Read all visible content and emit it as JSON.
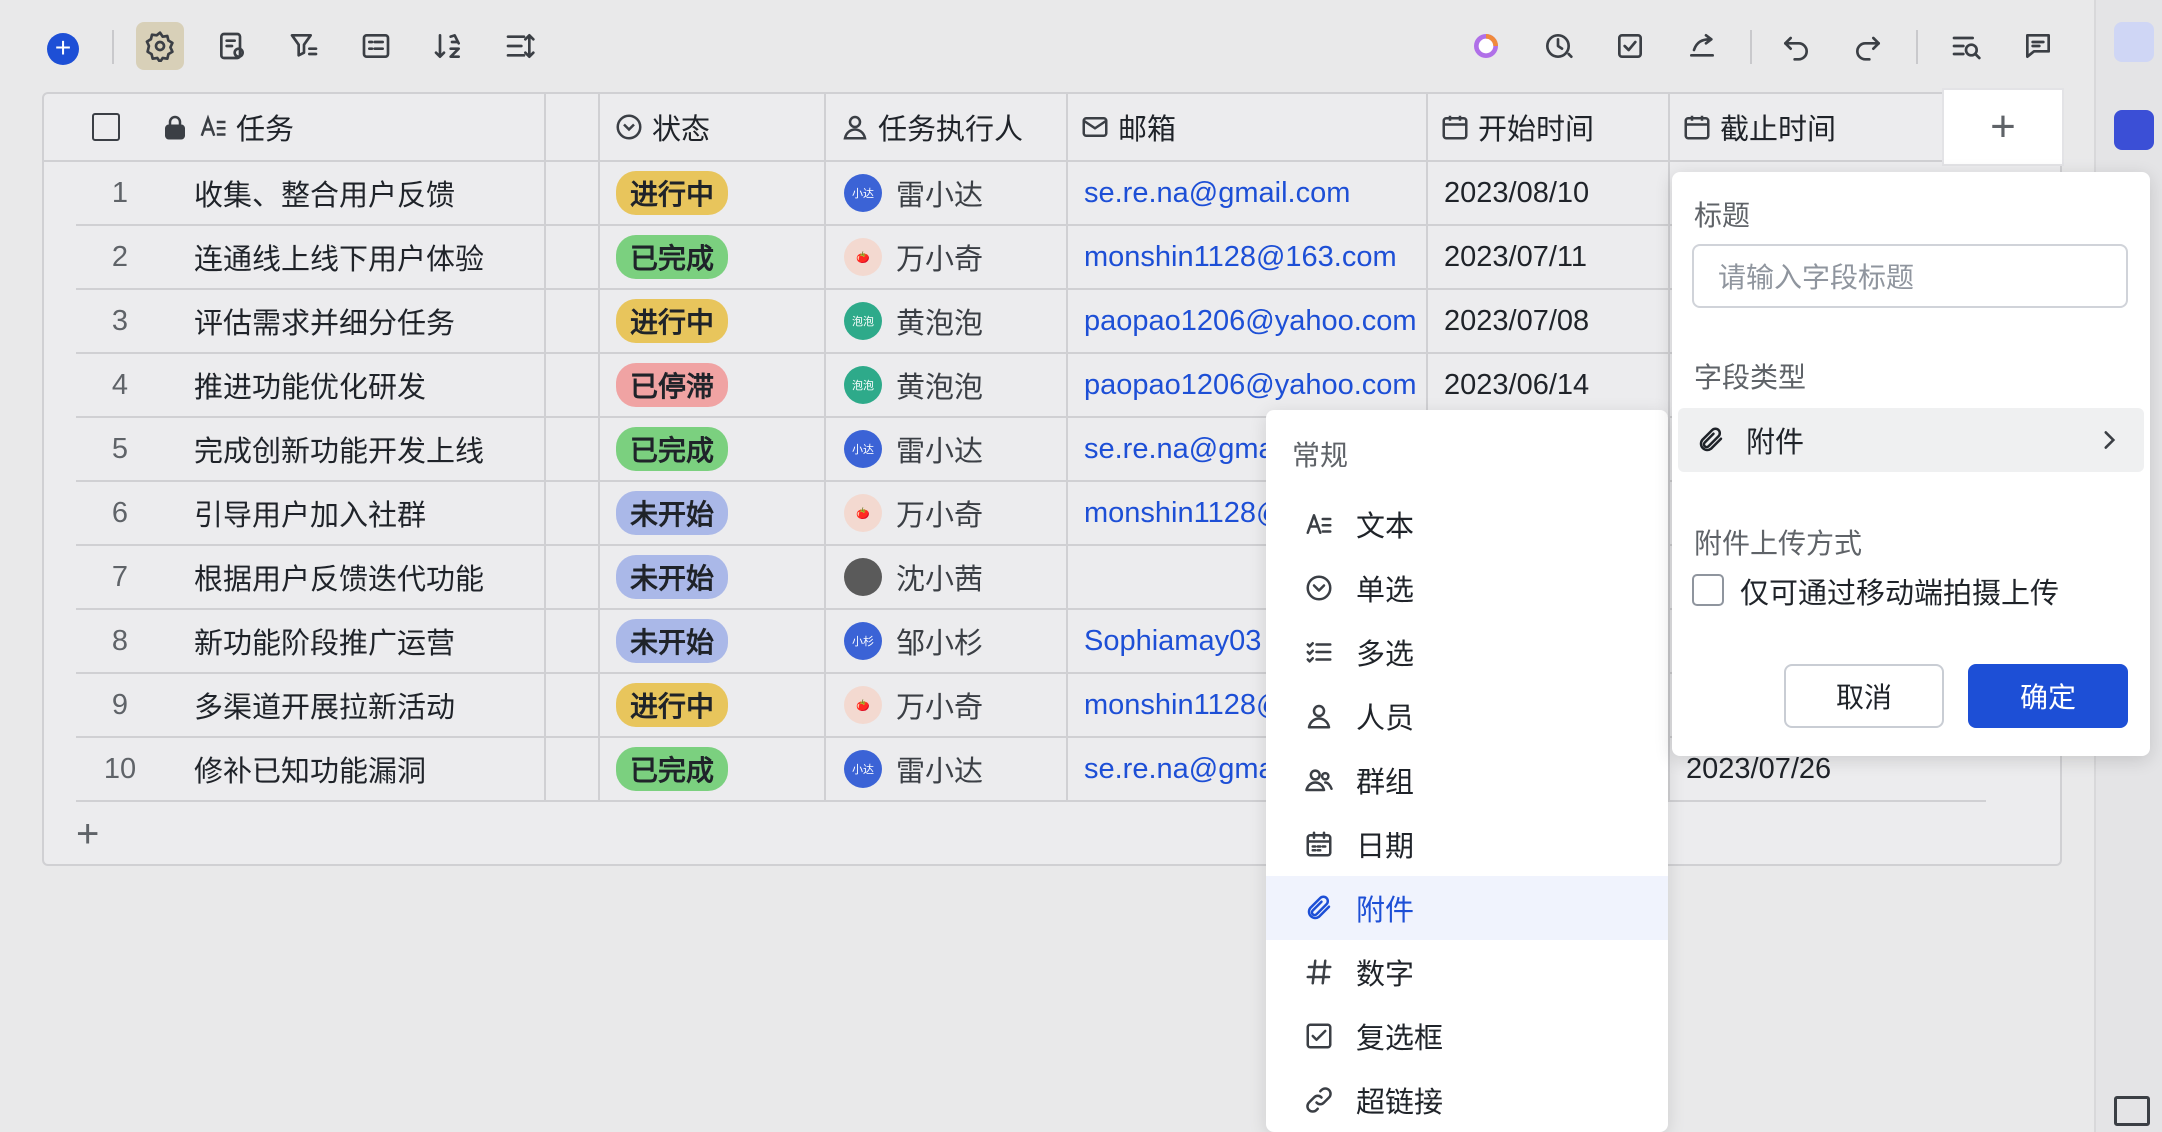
{
  "toolbar": {
    "left_tools": [
      "add",
      "settings",
      "field-settings",
      "filter",
      "group",
      "sort",
      "row-height"
    ],
    "right_tools": [
      "ai-assistant",
      "history",
      "task",
      "share",
      "undo",
      "redo",
      "search",
      "comments"
    ]
  },
  "columns": {
    "task": "任务",
    "status": "状态",
    "assignee": "任务执行人",
    "email": "邮箱",
    "start": "开始时间",
    "due": "截止时间"
  },
  "rows": [
    {
      "num": "1",
      "task": "收集、整合用户反馈",
      "status": "进行中",
      "status_color": "#e8c55c",
      "assignee": "雷小达",
      "avatar_text": "小达",
      "avatar_color": "#3b63d6",
      "email": "se.re.na@gmail.com",
      "start": "2023/08/10"
    },
    {
      "num": "2",
      "task": "连通线上线下用户体验",
      "status": "已完成",
      "status_color": "#7bd07f",
      "assignee": "万小奇",
      "avatar_text": "🍅",
      "avatar_color": "#f3d9d0",
      "email": "monshin1128@163.com",
      "start": "2023/07/11"
    },
    {
      "num": "3",
      "task": "评估需求并细分任务",
      "status": "进行中",
      "status_color": "#e8c55c",
      "assignee": "黄泡泡",
      "avatar_text": "泡泡",
      "avatar_color": "#2eaa8a",
      "email": "paopao1206@yahoo.com",
      "start": "2023/07/08"
    },
    {
      "num": "4",
      "task": "推进功能优化研发",
      "status": "已停滞",
      "status_color": "#f0a3a3",
      "assignee": "黄泡泡",
      "avatar_text": "泡泡",
      "avatar_color": "#2eaa8a",
      "email": "paopao1206@yahoo.com",
      "start": "2023/06/14"
    },
    {
      "num": "5",
      "task": "完成创新功能开发上线",
      "status": "已完成",
      "status_color": "#7bd07f",
      "assignee": "雷小达",
      "avatar_text": "小达",
      "avatar_color": "#3b63d6",
      "email": "se.re.na@gma",
      "start": ""
    },
    {
      "num": "6",
      "task": "引导用户加入社群",
      "status": "未开始",
      "status_color": "#aab8e8",
      "assignee": "万小奇",
      "avatar_text": "🍅",
      "avatar_color": "#f3d9d0",
      "email": "monshin1128@",
      "start": ""
    },
    {
      "num": "7",
      "task": "根据用户反馈迭代功能",
      "status": "未开始",
      "status_color": "#aab8e8",
      "assignee": "沈小茜",
      "avatar_text": "",
      "avatar_color": "#5a5a5a",
      "email": "",
      "start": ""
    },
    {
      "num": "8",
      "task": "新功能阶段推广运营",
      "status": "未开始",
      "status_color": "#aab8e8",
      "assignee": "邹小杉",
      "avatar_text": "小杉",
      "avatar_color": "#3b63d6",
      "email": "Sophiamay03",
      "start": ""
    },
    {
      "num": "9",
      "task": "多渠道开展拉新活动",
      "status": "进行中",
      "status_color": "#e8c55c",
      "assignee": "万小奇",
      "avatar_text": "🍅",
      "avatar_color": "#f3d9d0",
      "email": "monshin1128@",
      "start": ""
    },
    {
      "num": "10",
      "task": "修补已知功能漏洞",
      "status": "已完成",
      "status_color": "#7bd07f",
      "assignee": "雷小达",
      "avatar_text": "小达",
      "avatar_color": "#3b63d6",
      "email": "se.re.na@gma",
      "start": "",
      "due": "2023/07/26"
    }
  ],
  "add_row_label": "+",
  "add_column_label": "+",
  "dropdown": {
    "section_title": "常规",
    "items": [
      {
        "label": "文本",
        "icon": "text-icon"
      },
      {
        "label": "单选",
        "icon": "single-select-icon"
      },
      {
        "label": "多选",
        "icon": "multi-select-icon"
      },
      {
        "label": "人员",
        "icon": "person-icon"
      },
      {
        "label": "群组",
        "icon": "group-icon"
      },
      {
        "label": "日期",
        "icon": "calendar-icon"
      },
      {
        "label": "附件",
        "icon": "attachment-icon",
        "selected": true
      },
      {
        "label": "数字",
        "icon": "number-icon"
      },
      {
        "label": "复选框",
        "icon": "checkbox-icon"
      },
      {
        "label": "超链接",
        "icon": "link-icon"
      }
    ]
  },
  "panel": {
    "title_label": "标题",
    "title_placeholder": "请输入字段标题",
    "type_label": "字段类型",
    "type_value": "附件",
    "upload_label": "附件上传方式",
    "upload_option": "仅可通过移动端拍摄上传",
    "cancel": "取消",
    "confirm": "确定"
  },
  "colors": {
    "accent": "#1d4fd6",
    "selected_bg": "#f0f3fd"
  }
}
